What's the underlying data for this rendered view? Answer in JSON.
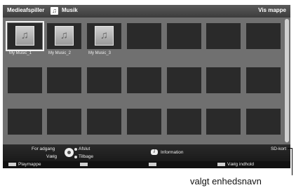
{
  "header": {
    "app_title": "Medieafspiller",
    "music_icon": "music-note-icon",
    "section_title": "Musik",
    "view_button": "Vis mappe"
  },
  "grid": {
    "rows": 3,
    "columns": 7,
    "selected_index": 0,
    "items": [
      {
        "label": "My Music_1",
        "icon": "music-note-icon"
      },
      {
        "label": "My Music_2",
        "icon": "music-note-icon"
      },
      {
        "label": "My Music_3",
        "icon": "music-note-icon"
      }
    ]
  },
  "footer": {
    "access_label": "For adgang",
    "select_label": "Vælg",
    "exit_label": "Afslut",
    "back_label": "Tilbage",
    "info_label": "Information",
    "device_label": "SD-kort"
  },
  "color_keys": {
    "red_label": "Playmappe",
    "green_label": "",
    "yellow_label": "",
    "blue_label": "Vælg indhold"
  },
  "callout": {
    "text": "valgt enhedsnavn"
  },
  "colors": {
    "grid_background": "#707070",
    "tile": "#2a2a2a",
    "header": "#3c3c3c",
    "footer": "#1a1a1a"
  }
}
